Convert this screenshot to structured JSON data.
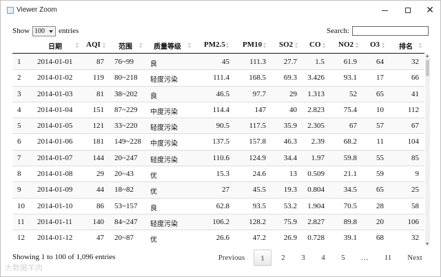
{
  "window": {
    "title": "Viewer Zoom"
  },
  "controls": {
    "show_label": "Show",
    "page_length": "100",
    "entries_label": "entries",
    "search_label": "Search:",
    "search_value": ""
  },
  "table": {
    "headers": [
      "日期",
      "AQI",
      "范围",
      "质量等级",
      "PM2.5",
      "PM10",
      "SO2",
      "CO",
      "NO2",
      "O3",
      "排名"
    ],
    "rows": [
      [
        "1",
        "2014-01-01",
        "87",
        "76~99",
        "良",
        "45",
        "111.3",
        "27.7",
        "1.5",
        "61.9",
        "64",
        "32"
      ],
      [
        "2",
        "2014-01-02",
        "119",
        "80~218",
        "轻度污染",
        "111.4",
        "168.5",
        "69.3",
        "3.426",
        "93.1",
        "17",
        "66"
      ],
      [
        "3",
        "2014-01-03",
        "81",
        "38~202",
        "良",
        "46.5",
        "97.7",
        "29",
        "1.313",
        "52",
        "65",
        "41"
      ],
      [
        "4",
        "2014-01-04",
        "151",
        "87~229",
        "中度污染",
        "114.4",
        "147",
        "40",
        "2.823",
        "75.4",
        "10",
        "112"
      ],
      [
        "5",
        "2014-01-05",
        "121",
        "33~220",
        "轻度污染",
        "90.5",
        "117.5",
        "35.9",
        "2.305",
        "67",
        "57",
        "67"
      ],
      [
        "6",
        "2014-01-06",
        "181",
        "149~228",
        "中度污染",
        "137.5",
        "157.8",
        "46.3",
        "2.39",
        "68.2",
        "11",
        "104"
      ],
      [
        "7",
        "2014-01-07",
        "144",
        "20~247",
        "轻度污染",
        "110.6",
        "124.9",
        "34.4",
        "1.97",
        "59.8",
        "55",
        "85"
      ],
      [
        "8",
        "2014-01-08",
        "29",
        "20~43",
        "优",
        "15.3",
        "24.6",
        "13",
        "0.509",
        "21.1",
        "59",
        "9"
      ],
      [
        "9",
        "2014-01-09",
        "44",
        "18~82",
        "优",
        "27",
        "45.5",
        "19.3",
        "0.804",
        "34.5",
        "65",
        "25"
      ],
      [
        "10",
        "2014-01-10",
        "86",
        "53~157",
        "良",
        "62.8",
        "93.5",
        "53.2",
        "1.904",
        "70.5",
        "28",
        "58"
      ],
      [
        "11",
        "2014-01-11",
        "140",
        "84~247",
        "轻度污染",
        "106.2",
        "128.2",
        "75.9",
        "2.827",
        "89.8",
        "20",
        "106"
      ],
      [
        "12",
        "2014-01-12",
        "47",
        "20~87",
        "优",
        "26.6",
        "47.2",
        "26.9",
        "0.728",
        "39.1",
        "68",
        "32"
      ]
    ]
  },
  "footer": {
    "info": "Showing 1 to 100 of 1,096 entries",
    "previous": "Previous",
    "pages": [
      "1",
      "2",
      "3",
      "4",
      "5",
      "…",
      "11"
    ],
    "next": "Next"
  },
  "watermark": "大数据羊肉"
}
